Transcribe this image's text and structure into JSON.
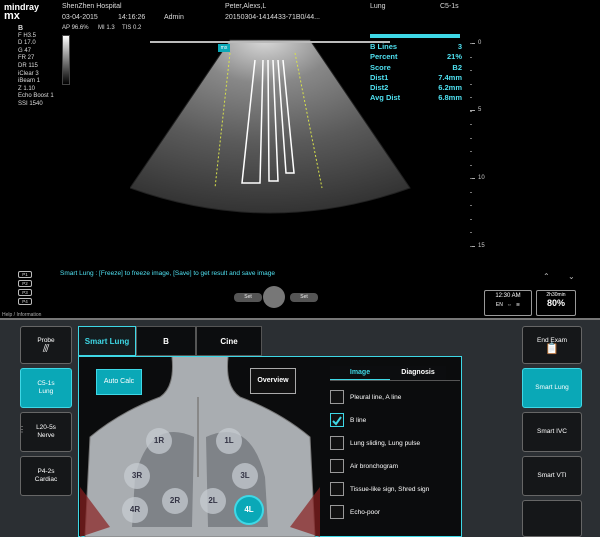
{
  "header": {
    "brand_top": "mindray",
    "brand_model": "mx",
    "hospital": "ShenZhen Hospital",
    "date": "03-04-2015",
    "time": "14:16:26",
    "operator": "Admin",
    "patient": "Peter,Alexs,L",
    "exam_id": "20150304-1414433-71B0/44...",
    "exam_type": "Lung",
    "probe": "C5-1s",
    "ap": "AP 96.6%",
    "mi": "MI 1.3",
    "tis": "TIS 0.2"
  },
  "params": [
    "B",
    "F H3.5",
    "D 17.0",
    "G 47",
    "FR 27",
    "DR 115",
    "iClear 3",
    "iBeam 1",
    "Z 1.10",
    "Echo Boost 1",
    "SSI 1540"
  ],
  "image_tag": "mx",
  "measurements": [
    {
      "label": "B Lines",
      "value": "3"
    },
    {
      "label": "Percent",
      "value": "21%"
    },
    {
      "label": "Score",
      "value": "B2"
    },
    {
      "label": "Dist1",
      "value": "7.4mm"
    },
    {
      "label": "Dist2",
      "value": "6.2mm"
    },
    {
      "label": "Avg Dist",
      "value": "6.8mm"
    }
  ],
  "depth_ticks": [
    "0",
    "5",
    "10",
    "15"
  ],
  "hint": "Smart Lung : [Freeze] to freeze image, [Save] to get result and save image",
  "presets": [
    "P1",
    "P2",
    "P3",
    "P4"
  ],
  "set_buttons": [
    "Set",
    "Set"
  ],
  "help_label": "Help / Information",
  "status": {
    "clock": "12:30 AM",
    "language": "EN",
    "battery_time": "2h30min",
    "battery_pct": "80%"
  },
  "left_panel": {
    "probe_label": "Probe",
    "probes": [
      {
        "line1": "C5-1s",
        "line2": "Lung",
        "active": true
      },
      {
        "line1": "L20-5s",
        "line2": "Nerve",
        "active": false
      },
      {
        "line1": "P4-2s",
        "line2": "Cardiac",
        "active": false
      }
    ]
  },
  "tabs": [
    "Smart Lung",
    "B",
    "Cine"
  ],
  "main": {
    "auto_calc": "Auto Calc",
    "overview": "Overview",
    "sub_tabs": [
      "Image",
      "Diagnosis"
    ],
    "zones": [
      "1R",
      "1L",
      "3R",
      "3L",
      "2R",
      "2L",
      "4R",
      "4L"
    ],
    "checks": [
      {
        "label": "Pleural line, A line",
        "checked": false
      },
      {
        "label": "B line",
        "checked": true
      },
      {
        "label": "Lung sliding, Lung pulse",
        "checked": false
      },
      {
        "label": "Air bronchogram",
        "checked": false
      },
      {
        "label": "Tissue-like sign, Shred sign",
        "checked": false
      },
      {
        "label": "Echo-poor",
        "checked": false
      }
    ]
  },
  "right_panel": {
    "end_exam": "End Exam",
    "buttons": [
      {
        "label": "Smart Lung",
        "active": true
      },
      {
        "label": "Smart IVC",
        "active": false
      },
      {
        "label": "Smart VTI",
        "active": false
      }
    ]
  },
  "colors": {
    "accent": "#3ed8e6",
    "active_bg": "#0aa8b7",
    "panel_bg": "#2b2f33"
  }
}
